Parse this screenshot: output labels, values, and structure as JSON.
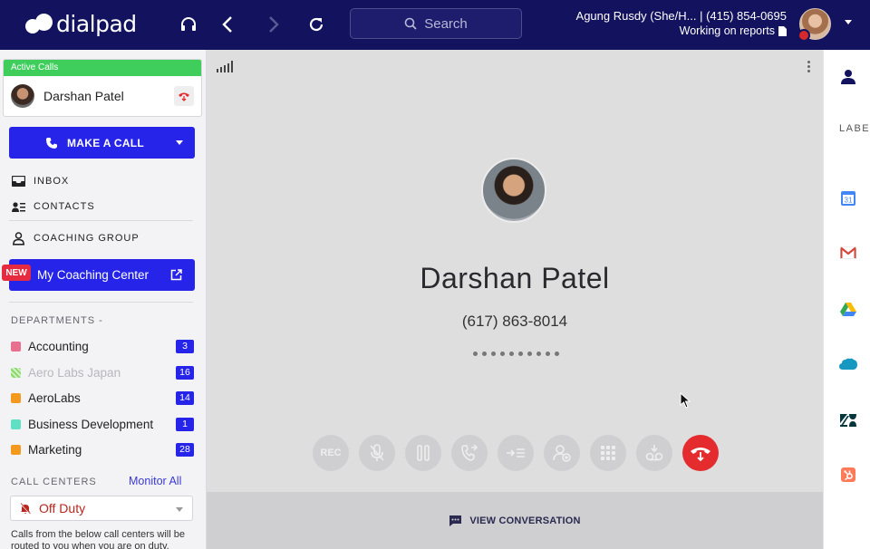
{
  "topbar": {
    "logo_text": "dialpad",
    "search_placeholder": "Search",
    "user_line": "Agung Rusdy (She/H... | (415) 854-0695",
    "user_status": "Working on reports"
  },
  "sidebar": {
    "active_calls": {
      "header": "Active Calls",
      "caller_name": "Darshan Patel"
    },
    "make_call_label": "MAKE A CALL",
    "nav": {
      "inbox": "INBOX",
      "contacts": "CONTACTS",
      "coaching_group": "COACHING GROUP"
    },
    "coaching_center": {
      "badge": "NEW",
      "label": "My Coaching Center"
    },
    "departments_header": "DEPARTMENTS  -",
    "departments": [
      {
        "name": "Accounting",
        "count": "3",
        "color": "#e96f8f",
        "dim": false
      },
      {
        "name": "Aero Labs Japan",
        "count": "16",
        "color": "#8bd96a",
        "dim": true
      },
      {
        "name": "AeroLabs",
        "count": "14",
        "color": "#f39a1e",
        "dim": false
      },
      {
        "name": "Business Development",
        "count": "1",
        "color": "#5fe0c3",
        "dim": false
      },
      {
        "name": "Marketing",
        "count": "28",
        "color": "#f39a1e",
        "dim": false
      }
    ],
    "call_centers_header": "CALL CENTERS",
    "monitor_all": "Monitor All",
    "duty_status": "Off Duty",
    "call_centers_note": "Calls from the below call centers will be routed to you when you are on duty."
  },
  "call": {
    "name": "Darshan Patel",
    "number": "(617) 863-8014",
    "controls": [
      "REC",
      "mute",
      "hold",
      "transfer",
      "forward",
      "add-person",
      "keypad",
      "voicemail",
      "hangup"
    ],
    "rec_label": "REC",
    "view_conversation": "VIEW CONVERSATION"
  },
  "rail": {
    "label": "LABE",
    "apps": [
      "google-calendar",
      "gmail",
      "google-drive",
      "salesforce",
      "zendesk",
      "hubspot"
    ]
  },
  "colors": {
    "topbar": "#13125e",
    "primary": "#2524e8",
    "hangup": "#e42c2f",
    "active_green": "#3fce5c"
  }
}
